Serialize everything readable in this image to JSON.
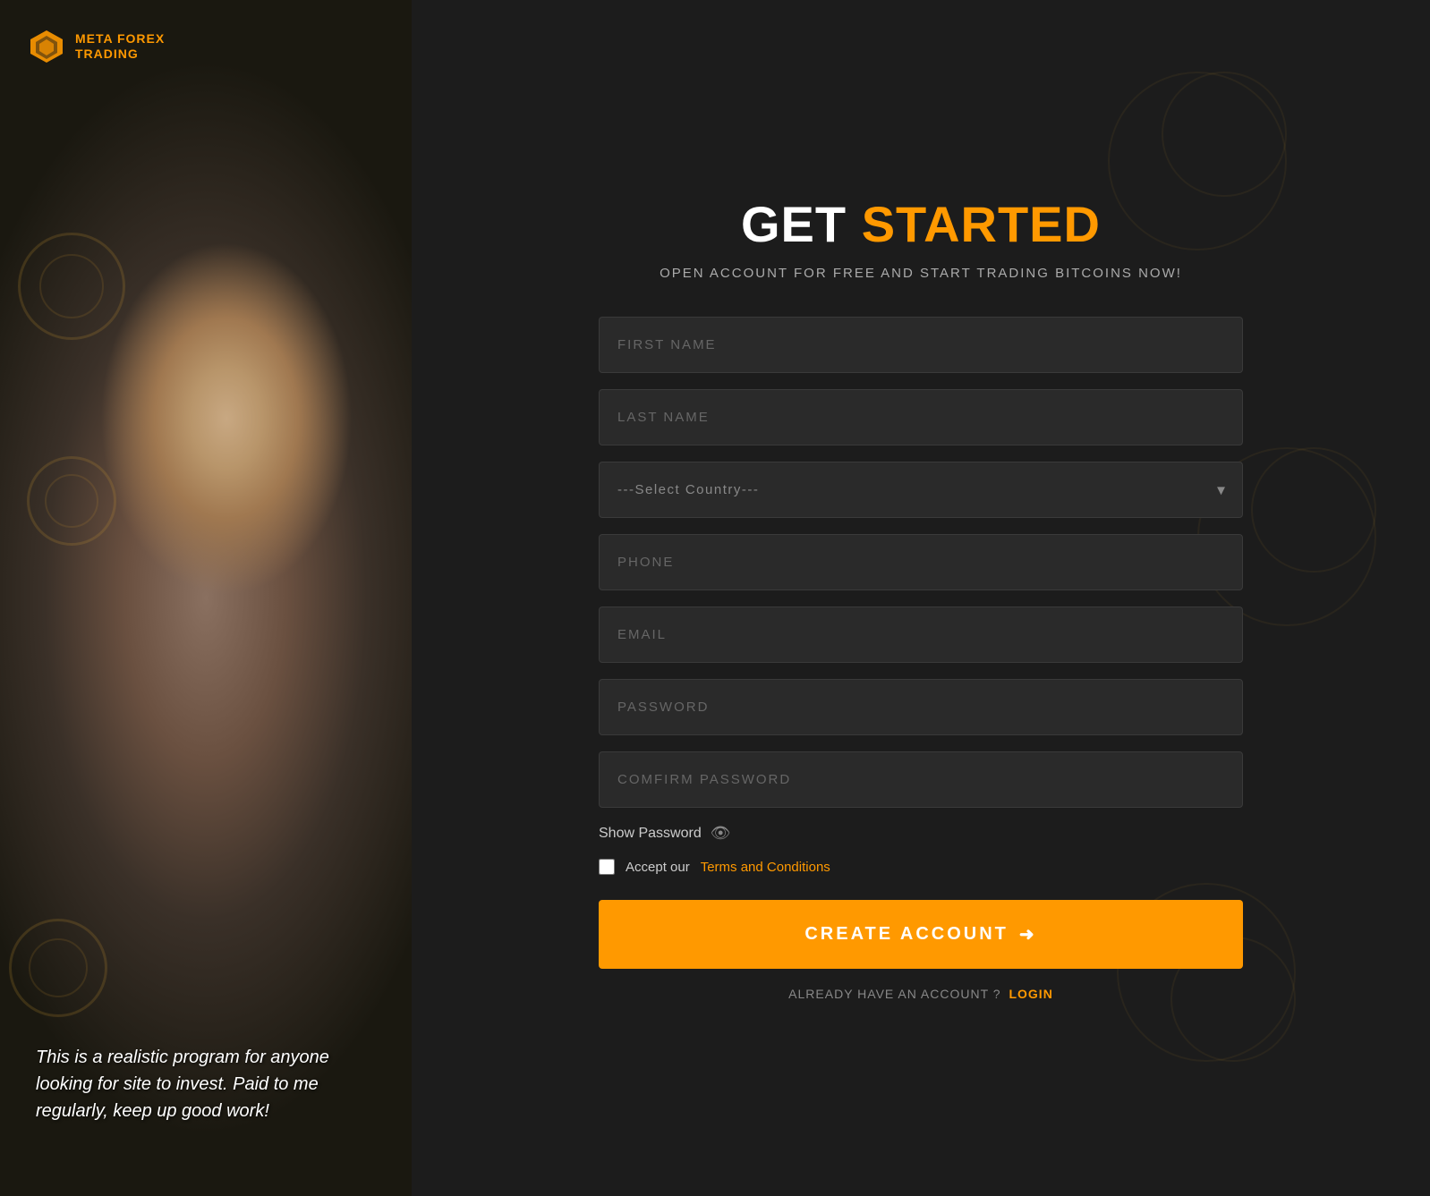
{
  "logo": {
    "title_line1": "META FOREX",
    "title_line2": "TRADING"
  },
  "header": {
    "title_get": "GET",
    "title_started": "STARTED",
    "subtitle": "OPEN ACCOUNT FOR FREE AND START TRADING BITCOINS NOW!"
  },
  "form": {
    "first_name_placeholder": "FIRST NAME",
    "last_name_placeholder": "LAST NAME",
    "country_placeholder": "---Select Country---",
    "phone_placeholder": "PHONE",
    "email_placeholder": "EMAIL",
    "password_placeholder": "PASSWORD",
    "confirm_password_placeholder": "COMFIRM PASSWORD",
    "show_password_label": "Show Password",
    "accept_label": "Accept our",
    "terms_label": "Terms and Conditions",
    "create_btn_label": "CREATE ACCOUNT",
    "already_account": "ALREADY HAVE AN ACCOUNT ?",
    "login_label": "LOGIN"
  },
  "tagline": {
    "text": "This is a realistic program for anyone looking for site to invest. Paid to me regularly, keep up good work!"
  },
  "colors": {
    "accent": "#ff9900",
    "bg_dark": "#1c1c1c",
    "input_bg": "#2a2a2a"
  }
}
